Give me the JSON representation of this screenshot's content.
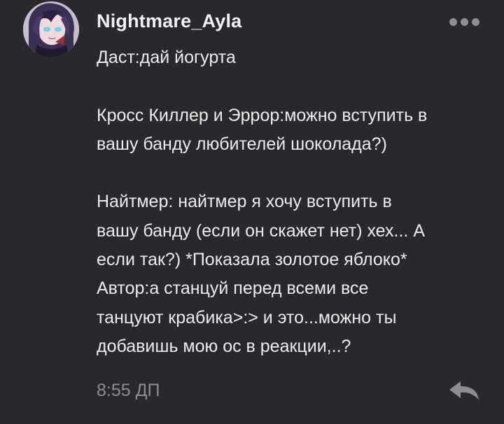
{
  "comment": {
    "username": "Nightmare_Ayla",
    "lines": [
      "Даст:дай йогурта",
      "",
      "Кросс Киллер и Эррор:можно вступить в",
      "вашу банду любителей шоколада?)",
      "",
      "Найтмер: найтмер я хочу вступить в",
      "вашу банду (если он скажет нет) хех... А",
      "если так?) *Показала золотое яблоко*",
      "Автор:а станцуй перед всеми все",
      "танцуют крабика>:> и это...можно ты",
      "добавишь мою ос в реакции,..?"
    ],
    "timestamp": "8:55 ДП"
  },
  "icons": {
    "more": "more-options-icon",
    "reply": "reply-arrow-icon"
  },
  "colors": {
    "background": "#29282c",
    "text": "#ececec",
    "muted": "#8e8d92"
  }
}
